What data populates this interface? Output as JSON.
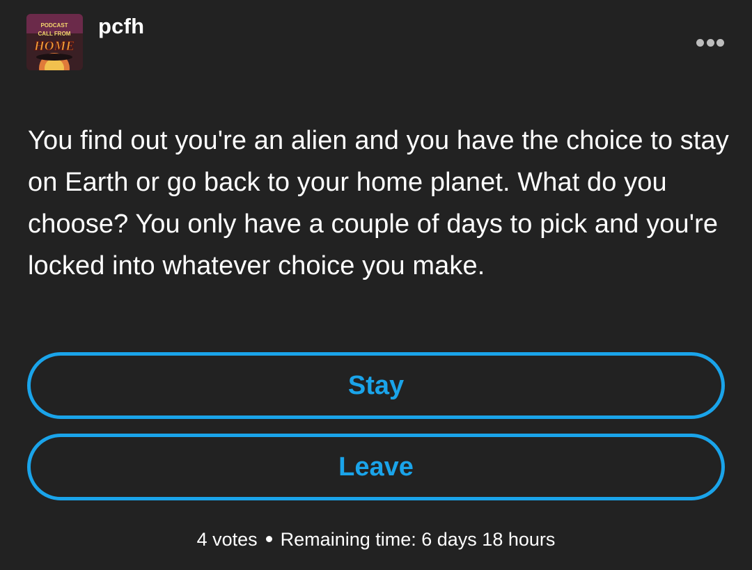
{
  "post": {
    "username": "pcfh",
    "avatar": {
      "icon": "podcast-logo-icon",
      "logo_text": [
        "PODCAST",
        "CALL FROM",
        "HOME"
      ]
    },
    "more_icon": "ellipsis-icon",
    "question": "You find out you're an alien and you have the choice to stay on Earth or go back to your home planet. What do you choose? You only have a couple of days to pick and you're locked into whatever choice you make.",
    "options": [
      {
        "label": "Stay"
      },
      {
        "label": "Leave"
      }
    ],
    "votes": "4 votes",
    "remaining": "Remaining time: 6 days 18 hours"
  },
  "colors": {
    "background": "#222222",
    "accent": "#1aa4ea",
    "text": "#ffffff"
  }
}
